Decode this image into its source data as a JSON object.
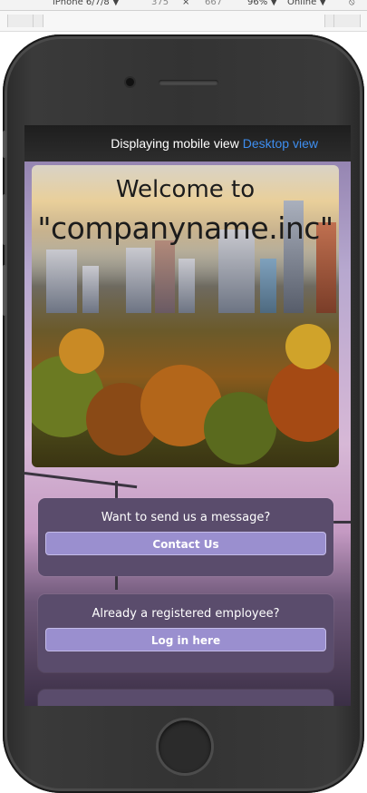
{
  "devtools": {
    "device": "iPhone 6/7/8 ▼",
    "width": "375",
    "times": "×",
    "height": "667",
    "zoom": "96% ▼",
    "network": "Online ▼"
  },
  "topbar": {
    "text": "Displaying mobile view",
    "link": "Desktop view"
  },
  "hero": {
    "line1": "Welcome to",
    "line2": "\"companyname.inc\""
  },
  "cards": [
    {
      "question": "Want to send us a message?",
      "button": "Contact Us"
    },
    {
      "question": "Already a registered employee?",
      "button": "Log in here"
    }
  ],
  "colors": {
    "card_bg": "#5a4c6c",
    "button_bg": "#9a8fcf",
    "link": "#3e8ef0"
  }
}
